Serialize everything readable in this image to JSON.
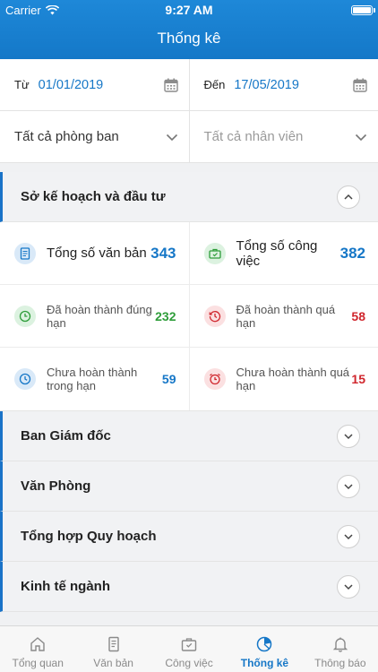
{
  "status": {
    "carrier": "Carrier",
    "time": "9:27 AM"
  },
  "header": {
    "title": "Thống kê"
  },
  "filters": {
    "from_label": "Từ",
    "from_date": "01/01/2019",
    "to_label": "Đến",
    "to_date": "17/05/2019",
    "department": "Tất cả phòng ban",
    "employee_placeholder": "Tất cả nhân viên"
  },
  "expanded": {
    "title": "Sở kế hoạch và đầu tư",
    "stats": {
      "total_docs_label": "Tổng số văn bản",
      "total_docs": "343",
      "total_tasks_label": "Tổng số công việc",
      "total_tasks": "382",
      "done_ontime_label": "Đã hoàn thành đúng hạn",
      "done_ontime": "232",
      "done_late_label": "Đã hoàn thành quá hạn",
      "done_late": "58",
      "pending_ontime_label": "Chưa hoàn thành trong hạn",
      "pending_ontime": "59",
      "pending_late_label": "Chưa hoàn thành quá hạn",
      "pending_late": "15"
    }
  },
  "sections": [
    "Ban Giám đốc",
    "Văn Phòng",
    "Tổng hợp Quy hoạch",
    "Kinh tế ngành"
  ],
  "tabs": [
    "Tổng quan",
    "Văn bản",
    "Công việc",
    "Thống kê",
    "Thông báo"
  ],
  "colors": {
    "brand": "#1677c7",
    "green": "#2e9d3a",
    "red": "#d0262d"
  }
}
